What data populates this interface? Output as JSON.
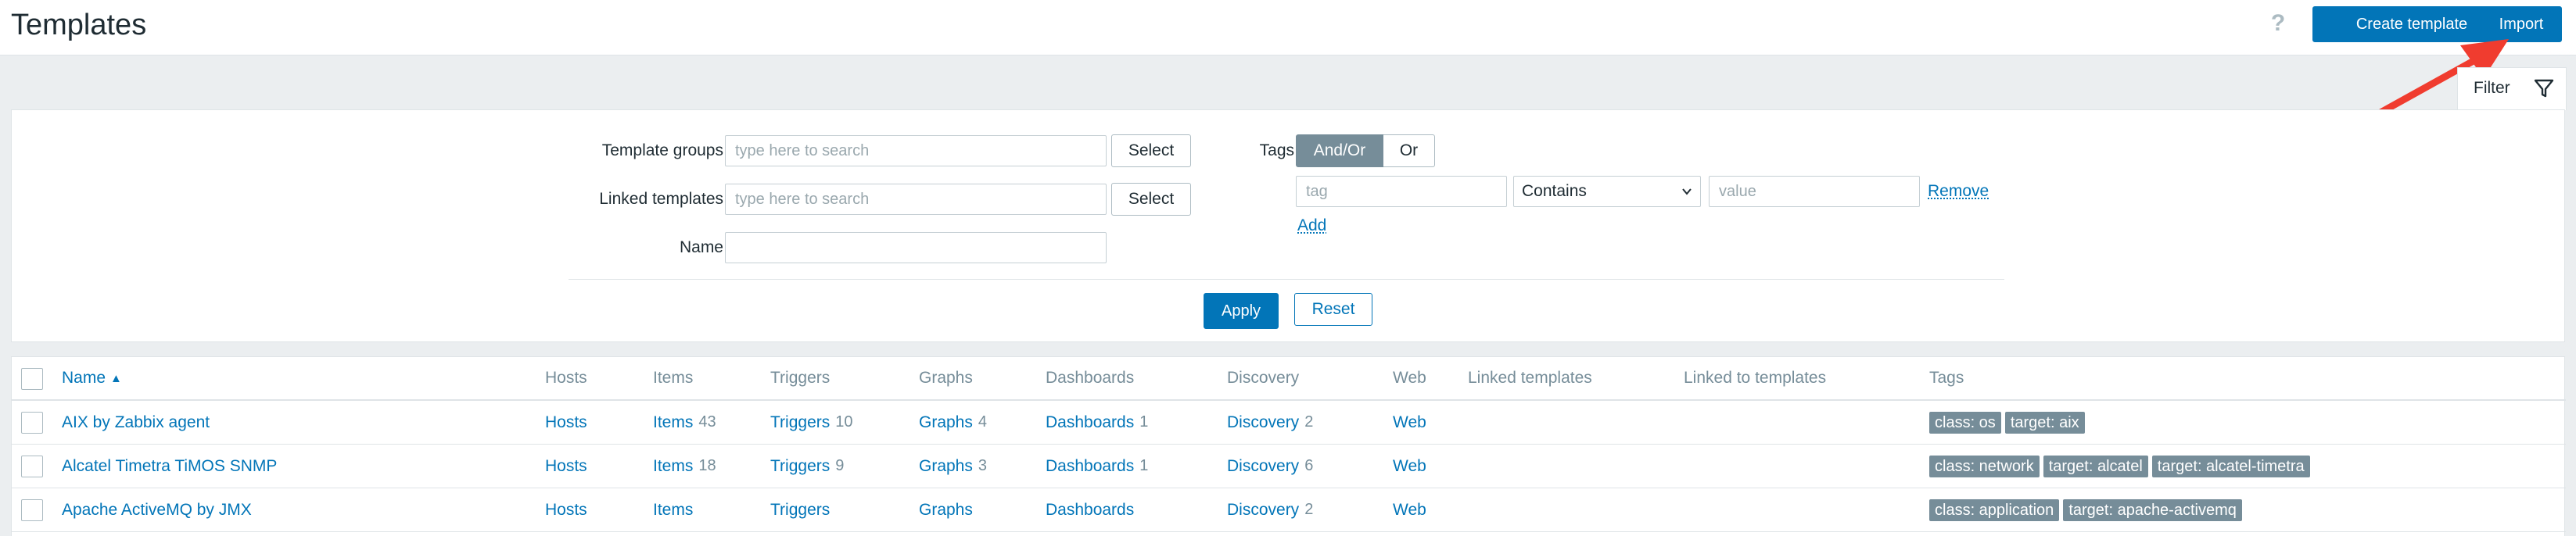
{
  "header": {
    "title": "Templates",
    "help": "?",
    "create_label": "Create template",
    "import_label": "Import"
  },
  "filter": {
    "tab_label": "Filter",
    "template_groups_label": "Template groups",
    "template_groups_placeholder": "type here to search",
    "linked_templates_label": "Linked templates",
    "linked_templates_placeholder": "type here to search",
    "name_label": "Name",
    "name_value": "",
    "select_label": "Select",
    "tags_label": "Tags",
    "tags_andor": "And/Or",
    "tags_or": "Or",
    "tag_placeholder": "tag",
    "operator_value": "Contains",
    "value_placeholder": "value",
    "remove_label": "Remove",
    "add_label": "Add",
    "apply_label": "Apply",
    "reset_label": "Reset"
  },
  "table": {
    "columns": {
      "name": "Name",
      "hosts": "Hosts",
      "items": "Items",
      "triggers": "Triggers",
      "graphs": "Graphs",
      "dashboards": "Dashboards",
      "discovery": "Discovery",
      "web": "Web",
      "linked_templates": "Linked templates",
      "linked_to": "Linked to templates",
      "tags": "Tags"
    },
    "sort_indicator": "▲",
    "rows": [
      {
        "name": "AIX by Zabbix agent",
        "hosts": "Hosts",
        "items": "Items",
        "items_count": "43",
        "triggers": "Triggers",
        "triggers_count": "10",
        "graphs": "Graphs",
        "graphs_count": "4",
        "dashboards": "Dashboards",
        "dashboards_count": "1",
        "discovery": "Discovery",
        "discovery_count": "2",
        "web": "Web",
        "tags": [
          "class: os",
          "target: aix"
        ]
      },
      {
        "name": "Alcatel Timetra TiMOS SNMP",
        "hosts": "Hosts",
        "items": "Items",
        "items_count": "18",
        "triggers": "Triggers",
        "triggers_count": "9",
        "graphs": "Graphs",
        "graphs_count": "3",
        "dashboards": "Dashboards",
        "dashboards_count": "1",
        "discovery": "Discovery",
        "discovery_count": "6",
        "web": "Web",
        "tags": [
          "class: network",
          "target: alcatel",
          "target: alcatel-timetra"
        ]
      },
      {
        "name": "Apache ActiveMQ by JMX",
        "hosts": "Hosts",
        "items": "Items",
        "items_count": "",
        "triggers": "Triggers",
        "triggers_count": "",
        "graphs": "Graphs",
        "graphs_count": "",
        "dashboards": "Dashboards",
        "dashboards_count": "",
        "discovery": "Discovery",
        "discovery_count": "2",
        "web": "Web",
        "tags": [
          "class: application",
          "target: apache-activemq"
        ]
      }
    ]
  },
  "colors": {
    "accent": "#0275b8",
    "tag_bg": "#768d99",
    "annotation_arrow": "#f03c2f"
  },
  "icons": {
    "filter": "filter-funnel-icon",
    "chevron": "chevron-down-icon",
    "help": "help-icon",
    "annotation": "red-arrow-annotation"
  }
}
